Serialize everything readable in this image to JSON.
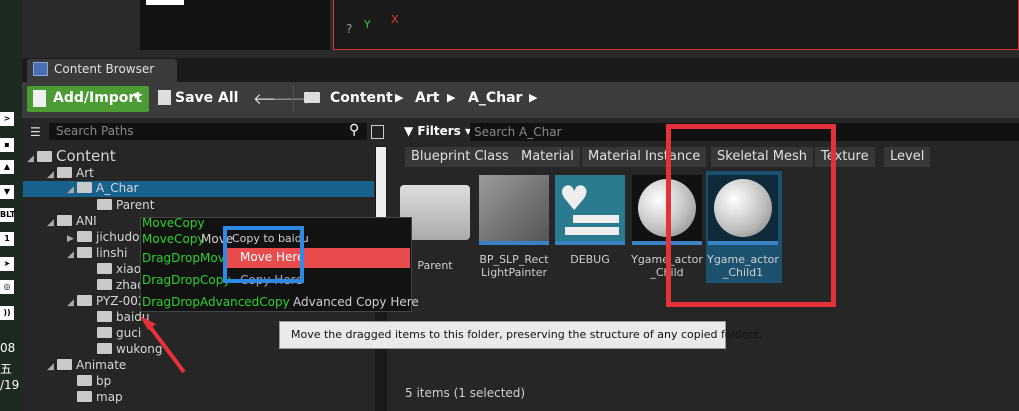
{
  "left_strip": {
    "glyphs": [
      ">",
      "▪",
      "▲",
      "▼",
      "BLT",
      "1",
      "➤",
      "◎",
      "))"
    ],
    "texts": [
      "08",
      "五",
      "/19"
    ]
  },
  "viewport": {
    "axis_y": "Y",
    "axis_x": "X"
  },
  "tab": {
    "label": "Content Browser"
  },
  "toolbar": {
    "add_import_label": "Add/Import",
    "save_all_label": "Save All",
    "breadcrumbs": [
      "Content",
      "Art",
      "A_Char"
    ]
  },
  "tree": {
    "search_placeholder": "Search Paths",
    "rows": [
      {
        "label": "Content",
        "depth": 0,
        "arrow": "◢"
      },
      {
        "label": "Art",
        "depth": 1,
        "arrow": "◢"
      },
      {
        "label": "A_Char",
        "depth": 2,
        "arrow": "◢",
        "selected": true
      },
      {
        "label": "Parent",
        "depth": 3,
        "arrow": ""
      },
      {
        "label": "ANI",
        "depth": 1,
        "arrow": "◢"
      },
      {
        "label": "jichudong",
        "depth": 2,
        "arrow": "▶"
      },
      {
        "label": "linshi",
        "depth": 2,
        "arrow": "◢"
      },
      {
        "label": "xiaoqiao",
        "depth": 3,
        "arrow": ""
      },
      {
        "label": "zhaoyun",
        "depth": 3,
        "arrow": ""
      },
      {
        "label": "PYZ-002j",
        "depth": 2,
        "arrow": "◢"
      },
      {
        "label": "baidu",
        "depth": 3,
        "arrow": ""
      },
      {
        "label": "guci",
        "depth": 3,
        "arrow": ""
      },
      {
        "label": "wukong",
        "depth": 3,
        "arrow": ""
      },
      {
        "label": "Animate",
        "depth": 1,
        "arrow": "◢"
      },
      {
        "label": "bp",
        "depth": 2,
        "arrow": ""
      },
      {
        "label": "map",
        "depth": 2,
        "arrow": ""
      }
    ]
  },
  "assets": {
    "filters_label": "Filters",
    "search_placeholder": "Search A_Char",
    "filter_chips": [
      "Blueprint Class",
      "Material",
      "Material Instance",
      "Skeletal Mesh",
      "Texture",
      "Level"
    ],
    "items": [
      {
        "label": "Parent",
        "kind": "folder"
      },
      {
        "label": "BP_SLP_RectLightPainter",
        "kind": "blueprint"
      },
      {
        "label": "DEBUG",
        "kind": "heart"
      },
      {
        "label": "Ygame_actor_Child",
        "kind": "sphere"
      },
      {
        "label": "Ygame_actor_Child1",
        "kind": "sphere",
        "selected": true
      }
    ],
    "status": "5 items (1 selected)"
  },
  "drag_menu": {
    "items": [
      "MoveCopy",
      "MoveCopy",
      "DragDropMove",
      "DragDropCopy",
      "DragDropAdvancedCopy"
    ],
    "copy_to": "Copy to baidu",
    "move_to_partial": "Move",
    "move_here": "Move Here",
    "copy_here": "Copy Here",
    "advanced_copy_here": "Advanced Copy Here"
  },
  "tooltip": {
    "text": "Move the dragged items to this folder, preserving the structure of any copied folders."
  },
  "colors": {
    "accent_green": "#4c9b33",
    "selection_blue": "#18618d",
    "annotation_red": "#e5323a",
    "annotation_blue": "#2e8ae6",
    "drag_green": "#2cd12c"
  }
}
